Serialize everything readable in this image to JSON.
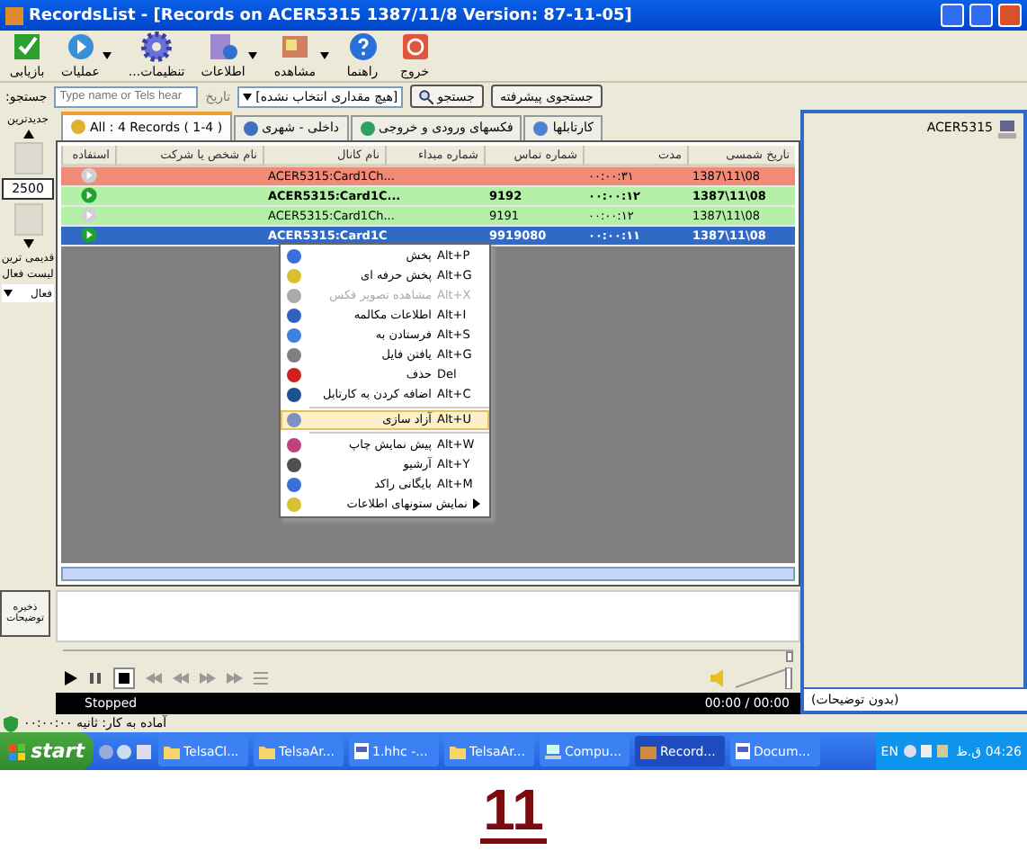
{
  "window": {
    "title": "RecordsList - [Records on ACER5315  1387/11/8 Version: 87-11-05]"
  },
  "toolbar": [
    {
      "label": "خروج",
      "dropdown": false
    },
    {
      "label": "راهنما",
      "dropdown": false
    },
    {
      "label": "مشاهده",
      "dropdown": true
    },
    {
      "label": "اطلاعات",
      "dropdown": true
    },
    {
      "label": "تنظیمات...",
      "dropdown": false
    },
    {
      "label": "عملیات",
      "dropdown": true
    },
    {
      "label": "بازیابی",
      "dropdown": false
    }
  ],
  "search": {
    "label": "جستجو:",
    "placeholder": "Type name or Tels hear",
    "date_label": "تاریخ",
    "date_value": "[هیچ مقداری انتخاب نشده]",
    "search_button": "جستجو",
    "advanced_button": "جستجوی پیشرفته"
  },
  "left_panel": {
    "newest": "جدیدترین",
    "count": "2500",
    "oldest": "قدیمی ترین",
    "list_label": "لیست فعال",
    "list_value": "فعال",
    "save_notes": "ذخیره توضیحات"
  },
  "tabs": [
    {
      "label": "کارتابلها",
      "selected": false
    },
    {
      "label": "فکسهای ورودی و خروجی",
      "selected": false
    },
    {
      "label": "داخلی - شهری",
      "selected": false
    },
    {
      "label": "All : 4 Records ( 1-4 )",
      "selected": true
    }
  ],
  "table": {
    "columns": [
      "تاریخ شمسی",
      "مدت",
      "شماره تماس",
      "شماره مبداء",
      "نام کانال",
      "نام شخص یا شرکت",
      "استفاده"
    ],
    "rows": [
      {
        "color": "#f28a78",
        "selected": false,
        "bold": false,
        "playable": false,
        "channel": "ACER5315:Card1Ch...",
        "duration": "۰۰:۰۰:۳۱",
        "date": "1387\\11\\08"
      },
      {
        "color": "#b4f0a8",
        "selected": false,
        "bold": true,
        "playable": true,
        "channel": "ACER5315:Card1C...",
        "call": "9192",
        "duration": "۰۰:۰۰:۱۲",
        "date": "1387\\11\\08"
      },
      {
        "color": "#b4f0a8",
        "selected": false,
        "bold": false,
        "playable": false,
        "channel": "ACER5315:Card1Ch...",
        "call": "9191",
        "duration": "۰۰:۰۰:۱۲",
        "date": "1387\\11\\08"
      },
      {
        "selected": true,
        "bold": true,
        "playable": true,
        "channel": "ACER5315:Card1C",
        "call": "9919080",
        "duration": "۰۰:۰۰:۱۱",
        "date": "1387\\11\\08"
      }
    ]
  },
  "context_menu": [
    {
      "kind": "item",
      "label": "پخش",
      "shortcut": "Alt+P",
      "disabled": false,
      "highlighted": false,
      "submenu": false
    },
    {
      "kind": "item",
      "label": "پخش حرفه ای",
      "shortcut": "Alt+G",
      "disabled": false,
      "highlighted": false,
      "submenu": false
    },
    {
      "kind": "item",
      "label": "مشاهده تصویر فکس",
      "shortcut": "Alt+X",
      "disabled": true,
      "highlighted": false,
      "submenu": false
    },
    {
      "kind": "item",
      "label": "اطلاعات مکالمه",
      "shortcut": "Alt+I",
      "disabled": false,
      "highlighted": false,
      "submenu": false
    },
    {
      "kind": "item",
      "label": "فرستادن به",
      "shortcut": "Alt+S",
      "disabled": false,
      "highlighted": false,
      "submenu": false
    },
    {
      "kind": "item",
      "label": "یافتن فایل",
      "shortcut": "Alt+G",
      "disabled": false,
      "highlighted": false,
      "submenu": false
    },
    {
      "kind": "item",
      "label": "حذف",
      "shortcut": "Del",
      "disabled": false,
      "highlighted": false,
      "submenu": false
    },
    {
      "kind": "item",
      "label": "اضافه کردن به کارتابل",
      "shortcut": "Alt+C",
      "disabled": false,
      "highlighted": false,
      "submenu": false
    },
    {
      "kind": "separator"
    },
    {
      "kind": "item",
      "label": "آزاد سازی",
      "shortcut": "Alt+U",
      "disabled": false,
      "highlighted": true,
      "submenu": false
    },
    {
      "kind": "separator"
    },
    {
      "kind": "item",
      "label": "پیش نمایش چاپ",
      "shortcut": "Alt+W",
      "disabled": false,
      "highlighted": false,
      "submenu": false
    },
    {
      "kind": "item",
      "label": "آرشیو",
      "shortcut": "Alt+Y",
      "disabled": false,
      "highlighted": false,
      "submenu": false
    },
    {
      "kind": "item",
      "label": "بایگانی راکد",
      "shortcut": "Alt+M",
      "disabled": false,
      "highlighted": false,
      "submenu": false
    },
    {
      "kind": "item",
      "label": "نمایش ستونهای اطلاعات",
      "disabled": false,
      "highlighted": false,
      "submenu": true
    }
  ],
  "player": {
    "seek": {
      "level": 1
    },
    "volume": {
      "level": 1
    },
    "status": "Stopped",
    "time": "00:00 / 00:00"
  },
  "status_bar": "آماده به کار: ثانیه ۰۰:۰۰:۰۰",
  "right_panel": {
    "computer": "ACER5315",
    "notes": "(بدون توضیحات)"
  },
  "taskbar": {
    "start": "start",
    "tasks": [
      {
        "label": "Docum...",
        "selected": false
      },
      {
        "label": "Record...",
        "selected": true
      },
      {
        "label": "Compu...",
        "selected": false
      },
      {
        "label": "TelsaAr...",
        "selected": false
      },
      {
        "label": "1.hhc -...",
        "selected": false
      },
      {
        "label": "TelsaAr...",
        "selected": false
      },
      {
        "label": "TelsaCl...",
        "selected": false
      }
    ],
    "language": "EN",
    "clock": "04:26 ق.ظ"
  },
  "page_number": "11"
}
